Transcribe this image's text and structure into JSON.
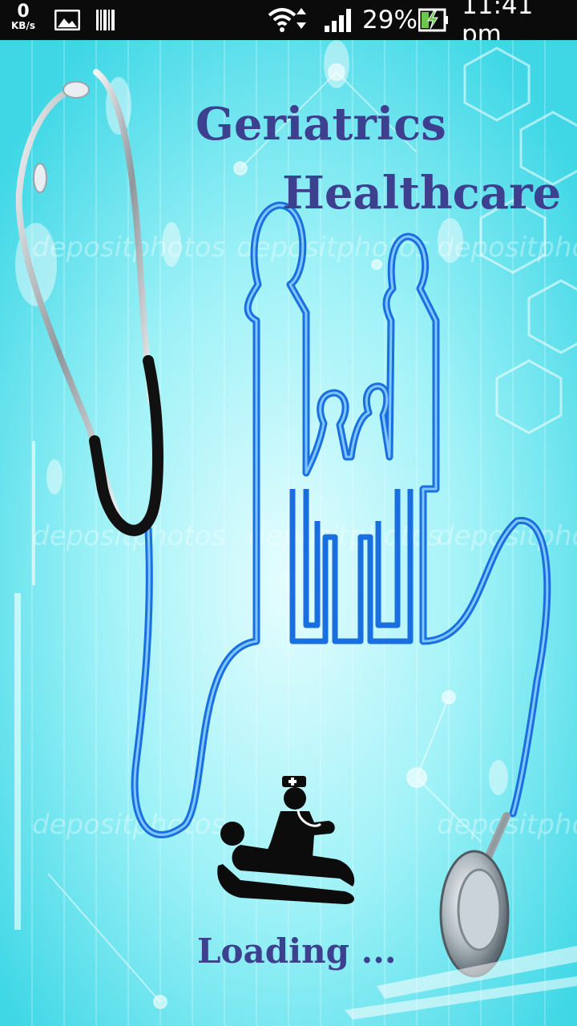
{
  "status_bar": {
    "net_speed": "0",
    "net_speed_unit": "KB/s",
    "battery_percent": "29%",
    "time": "11:41 pm"
  },
  "splash": {
    "title_line1": "Geriatrics",
    "title_line2": "Healthcare",
    "loading_text": "Loading ...",
    "watermark_text": "depositphotos",
    "colors": {
      "title": "#3d3f8f",
      "background": "#7fe8f0",
      "family_outline": "#1a6fe0"
    }
  }
}
